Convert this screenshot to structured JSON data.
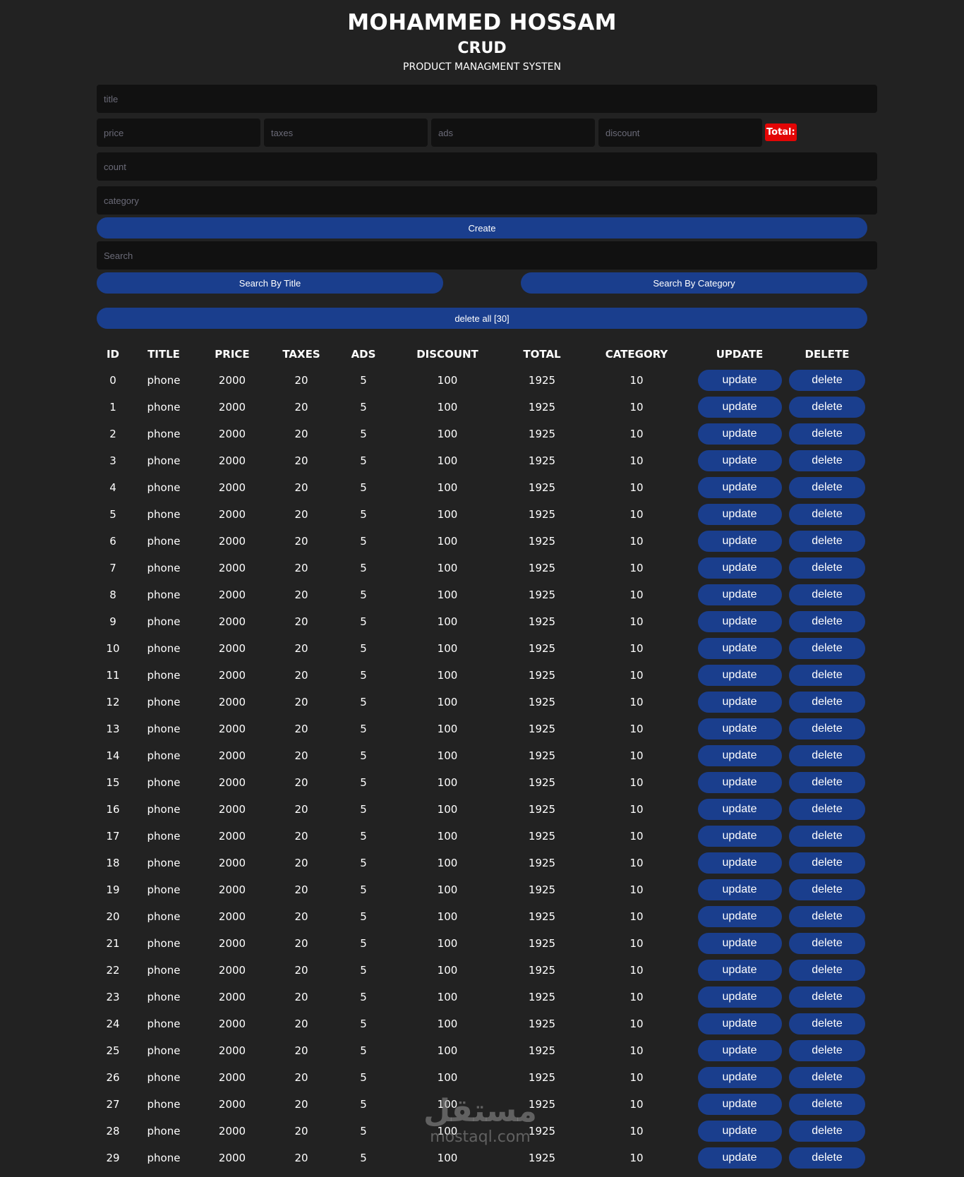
{
  "header": {
    "name": "MOHAMMED HOSSAM",
    "app": "CRUD",
    "subtitle": "PRODUCT MANAGMENT SYSTEN"
  },
  "form": {
    "title_placeholder": "title",
    "price_placeholder": "price",
    "taxes_placeholder": "taxes",
    "ads_placeholder": "ads",
    "discount_placeholder": "discount",
    "total_label": "Total:",
    "count_placeholder": "count",
    "category_placeholder": "category",
    "create_label": "Create"
  },
  "search": {
    "placeholder": "Search",
    "by_title_label": "Search By Title",
    "by_category_label": "Search By Category"
  },
  "delete_all_label": "delete all [30]",
  "colors": {
    "accent": "#1a3e8d",
    "total_badge": "#e30505",
    "background": "#222222",
    "input": "#111111"
  },
  "table": {
    "headers": [
      "ID",
      "TITLE",
      "PRICE",
      "TAXES",
      "ADS",
      "DISCOUNT",
      "TOTAL",
      "CATEGORY",
      "UPDATE",
      "DELETE"
    ],
    "update_label": "update",
    "delete_label": "delete",
    "rows": [
      {
        "id": "0",
        "title": "phone",
        "price": "2000",
        "taxes": "20",
        "ads": "5",
        "discount": "100",
        "total": "1925",
        "category": "10"
      },
      {
        "id": "1",
        "title": "phone",
        "price": "2000",
        "taxes": "20",
        "ads": "5",
        "discount": "100",
        "total": "1925",
        "category": "10"
      },
      {
        "id": "2",
        "title": "phone",
        "price": "2000",
        "taxes": "20",
        "ads": "5",
        "discount": "100",
        "total": "1925",
        "category": "10"
      },
      {
        "id": "3",
        "title": "phone",
        "price": "2000",
        "taxes": "20",
        "ads": "5",
        "discount": "100",
        "total": "1925",
        "category": "10"
      },
      {
        "id": "4",
        "title": "phone",
        "price": "2000",
        "taxes": "20",
        "ads": "5",
        "discount": "100",
        "total": "1925",
        "category": "10"
      },
      {
        "id": "5",
        "title": "phone",
        "price": "2000",
        "taxes": "20",
        "ads": "5",
        "discount": "100",
        "total": "1925",
        "category": "10"
      },
      {
        "id": "6",
        "title": "phone",
        "price": "2000",
        "taxes": "20",
        "ads": "5",
        "discount": "100",
        "total": "1925",
        "category": "10"
      },
      {
        "id": "7",
        "title": "phone",
        "price": "2000",
        "taxes": "20",
        "ads": "5",
        "discount": "100",
        "total": "1925",
        "category": "10"
      },
      {
        "id": "8",
        "title": "phone",
        "price": "2000",
        "taxes": "20",
        "ads": "5",
        "discount": "100",
        "total": "1925",
        "category": "10"
      },
      {
        "id": "9",
        "title": "phone",
        "price": "2000",
        "taxes": "20",
        "ads": "5",
        "discount": "100",
        "total": "1925",
        "category": "10"
      },
      {
        "id": "10",
        "title": "phone",
        "price": "2000",
        "taxes": "20",
        "ads": "5",
        "discount": "100",
        "total": "1925",
        "category": "10"
      },
      {
        "id": "11",
        "title": "phone",
        "price": "2000",
        "taxes": "20",
        "ads": "5",
        "discount": "100",
        "total": "1925",
        "category": "10"
      },
      {
        "id": "12",
        "title": "phone",
        "price": "2000",
        "taxes": "20",
        "ads": "5",
        "discount": "100",
        "total": "1925",
        "category": "10"
      },
      {
        "id": "13",
        "title": "phone",
        "price": "2000",
        "taxes": "20",
        "ads": "5",
        "discount": "100",
        "total": "1925",
        "category": "10"
      },
      {
        "id": "14",
        "title": "phone",
        "price": "2000",
        "taxes": "20",
        "ads": "5",
        "discount": "100",
        "total": "1925",
        "category": "10"
      },
      {
        "id": "15",
        "title": "phone",
        "price": "2000",
        "taxes": "20",
        "ads": "5",
        "discount": "100",
        "total": "1925",
        "category": "10"
      },
      {
        "id": "16",
        "title": "phone",
        "price": "2000",
        "taxes": "20",
        "ads": "5",
        "discount": "100",
        "total": "1925",
        "category": "10"
      },
      {
        "id": "17",
        "title": "phone",
        "price": "2000",
        "taxes": "20",
        "ads": "5",
        "discount": "100",
        "total": "1925",
        "category": "10"
      },
      {
        "id": "18",
        "title": "phone",
        "price": "2000",
        "taxes": "20",
        "ads": "5",
        "discount": "100",
        "total": "1925",
        "category": "10"
      },
      {
        "id": "19",
        "title": "phone",
        "price": "2000",
        "taxes": "20",
        "ads": "5",
        "discount": "100",
        "total": "1925",
        "category": "10"
      },
      {
        "id": "20",
        "title": "phone",
        "price": "2000",
        "taxes": "20",
        "ads": "5",
        "discount": "100",
        "total": "1925",
        "category": "10"
      },
      {
        "id": "21",
        "title": "phone",
        "price": "2000",
        "taxes": "20",
        "ads": "5",
        "discount": "100",
        "total": "1925",
        "category": "10"
      },
      {
        "id": "22",
        "title": "phone",
        "price": "2000",
        "taxes": "20",
        "ads": "5",
        "discount": "100",
        "total": "1925",
        "category": "10"
      },
      {
        "id": "23",
        "title": "phone",
        "price": "2000",
        "taxes": "20",
        "ads": "5",
        "discount": "100",
        "total": "1925",
        "category": "10"
      },
      {
        "id": "24",
        "title": "phone",
        "price": "2000",
        "taxes": "20",
        "ads": "5",
        "discount": "100",
        "total": "1925",
        "category": "10"
      },
      {
        "id": "25",
        "title": "phone",
        "price": "2000",
        "taxes": "20",
        "ads": "5",
        "discount": "100",
        "total": "1925",
        "category": "10"
      },
      {
        "id": "26",
        "title": "phone",
        "price": "2000",
        "taxes": "20",
        "ads": "5",
        "discount": "100",
        "total": "1925",
        "category": "10"
      },
      {
        "id": "27",
        "title": "phone",
        "price": "2000",
        "taxes": "20",
        "ads": "5",
        "discount": "100",
        "total": "1925",
        "category": "10"
      },
      {
        "id": "28",
        "title": "phone",
        "price": "2000",
        "taxes": "20",
        "ads": "5",
        "discount": "100",
        "total": "1925",
        "category": "10"
      },
      {
        "id": "29",
        "title": "phone",
        "price": "2000",
        "taxes": "20",
        "ads": "5",
        "discount": "100",
        "total": "1925",
        "category": "10"
      }
    ]
  },
  "watermark": {
    "arabic": "مستقل",
    "latin": "mostaql.com"
  }
}
